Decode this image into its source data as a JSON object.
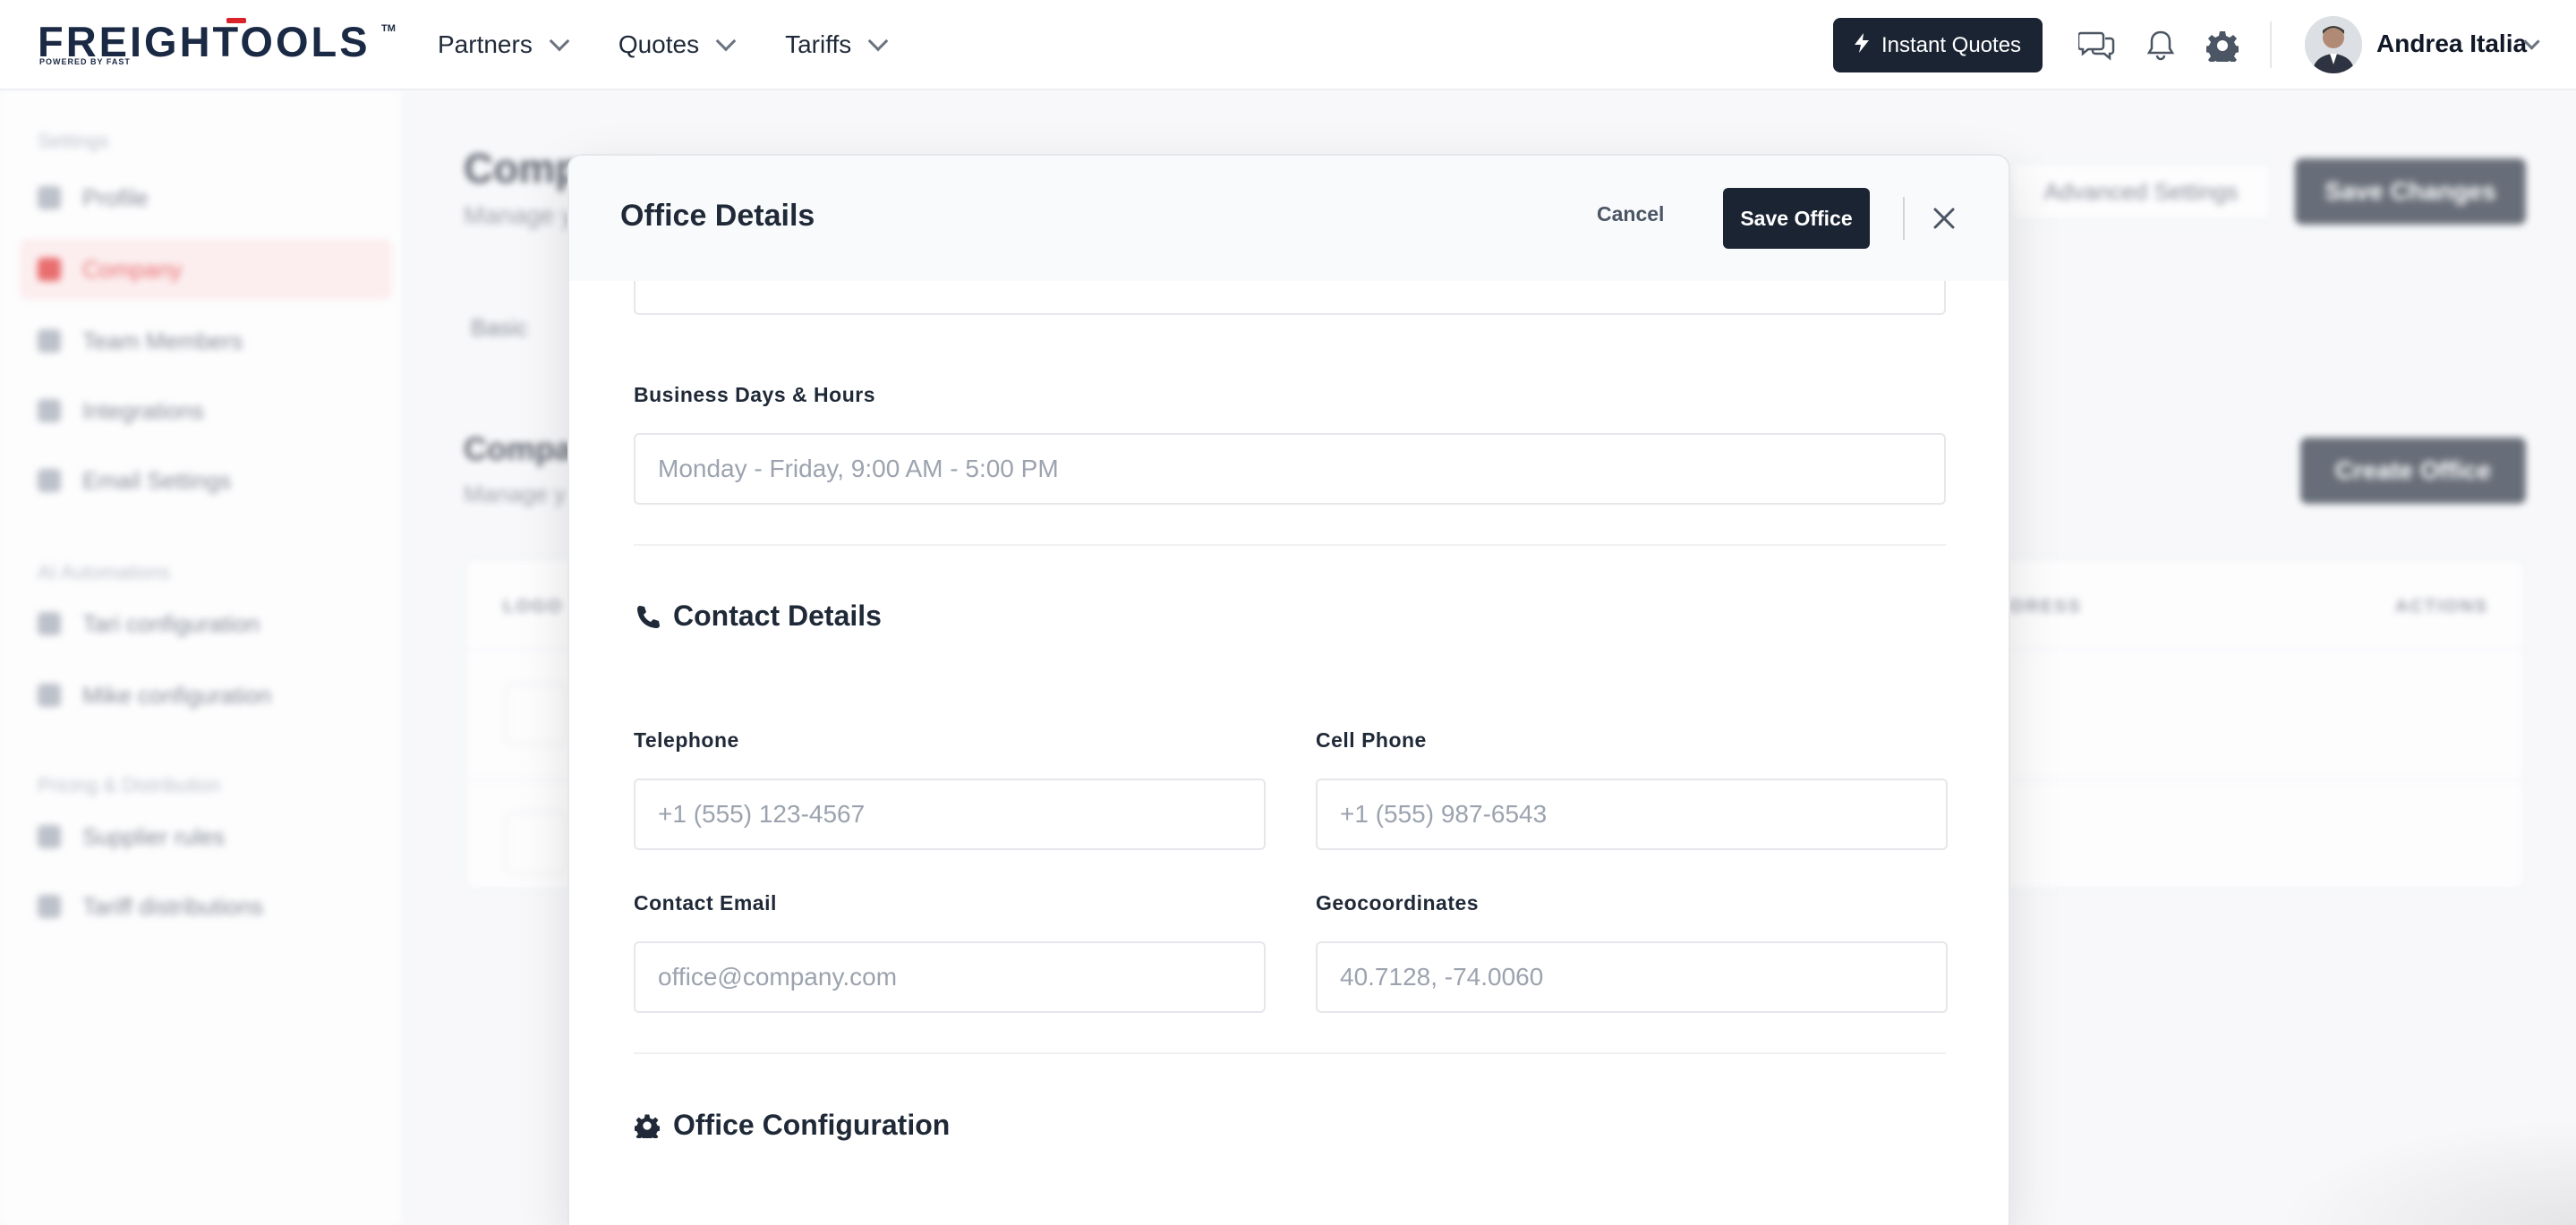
{
  "brand": {
    "logo_text": "FREIGHTOOLS",
    "tm": "TM",
    "powered_by": "POWERED BY FAST"
  },
  "nav": {
    "items": [
      {
        "label": "Partners"
      },
      {
        "label": "Quotes"
      },
      {
        "label": "Tariffs"
      }
    ]
  },
  "header": {
    "instant_quotes_label": "Instant Quotes",
    "user_name": "Andrea Italia"
  },
  "background_page": {
    "sidebar": {
      "section_settings": "Settings",
      "items": [
        {
          "label": "Profile"
        },
        {
          "label": "Company"
        },
        {
          "label": "Team Members"
        },
        {
          "label": "Integrations"
        },
        {
          "label": "Email Settings"
        }
      ],
      "section_ai": "AI Automations",
      "ai_items": [
        {
          "label": "Tari configuration"
        },
        {
          "label": "Mike configuration"
        }
      ],
      "section_pricing": "Pricing & Distribution",
      "pricing_items": [
        {
          "label": "Supplier rules"
        },
        {
          "label": "Tariff distributions"
        }
      ]
    },
    "title": "Company",
    "subtitle": "Manage y",
    "advanced_settings_label": "Advanced Settings",
    "save_changes_label": "Save Changes",
    "tab_basic": "Basic",
    "offices_title": "Compa",
    "offices_subtitle": "Manage y",
    "create_office_label": "Create Office",
    "table": {
      "col_logo": "LOGO",
      "col_address": "ADDRESS",
      "col_actions": "ACTIONS"
    }
  },
  "modal": {
    "title": "Office Details",
    "cancel_label": "Cancel",
    "save_label": "Save Office",
    "business_hours": {
      "label": "Business Days & Hours",
      "placeholder": "Monday - Friday, 9:00 AM - 5:00 PM"
    },
    "contact_section": {
      "title": "Contact Details",
      "telephone": {
        "label": "Telephone",
        "placeholder": "+1 (555) 123-4567"
      },
      "cell_phone": {
        "label": "Cell Phone",
        "placeholder": "+1 (555) 987-6543"
      },
      "contact_email": {
        "label": "Contact Email",
        "placeholder": "office@company.com"
      },
      "geocoordinates": {
        "label": "Geocoordinates",
        "placeholder": "40.7128, -74.0060"
      }
    },
    "config_section": {
      "title": "Office Configuration"
    }
  },
  "colors": {
    "primary_dark": "#1b2433",
    "brand_red": "#d8232a",
    "logo_navy": "#1b2a44"
  }
}
